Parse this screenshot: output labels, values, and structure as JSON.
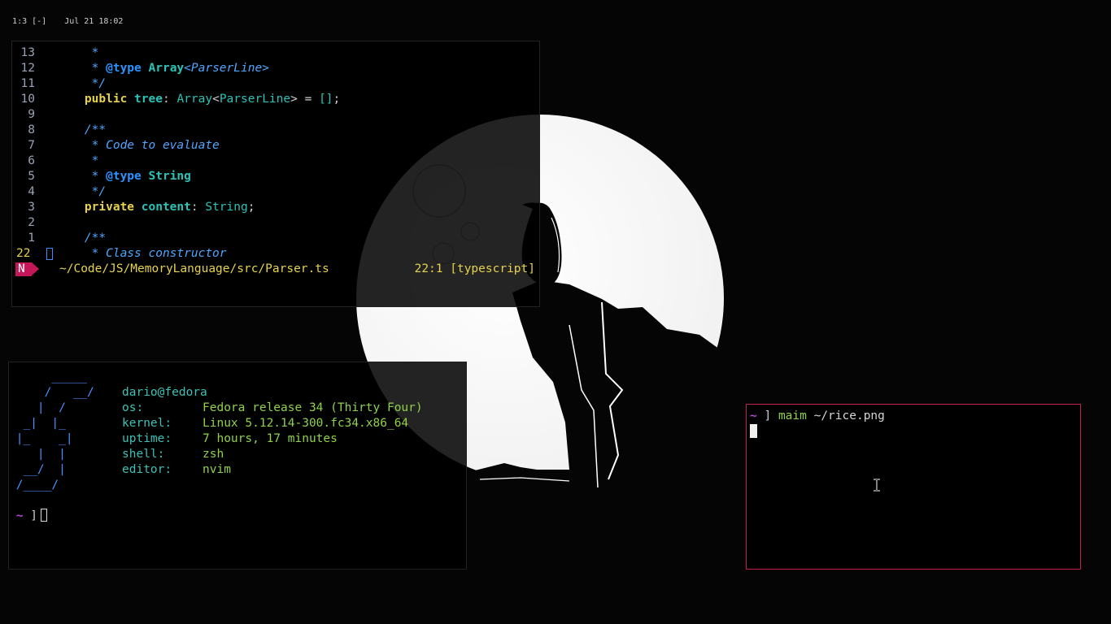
{
  "statusbar": {
    "workspaces": "1:3 [-]",
    "datetime": "Jul 21 18:02"
  },
  "editor": {
    "lines": [
      {
        "num": "13",
        "current": false,
        "tokens": [
          [
            "c-comment",
            "     *"
          ]
        ]
      },
      {
        "num": "12",
        "current": false,
        "tokens": [
          [
            "c-comment",
            "     * "
          ],
          [
            "c-tag",
            "@type"
          ],
          [
            "c-comment",
            " "
          ],
          [
            "c-type",
            "Array"
          ],
          [
            "c-gen",
            "<ParserLine>"
          ]
        ]
      },
      {
        "num": "11",
        "current": false,
        "tokens": [
          [
            "c-comment",
            "     */"
          ]
        ]
      },
      {
        "num": "10",
        "current": false,
        "tokens": [
          [
            "c-plain",
            "    "
          ],
          [
            "c-kw",
            "public"
          ],
          [
            "c-plain",
            " "
          ],
          [
            "c-prop",
            "tree"
          ],
          [
            "c-punc",
            ": "
          ],
          [
            "c-typ",
            "Array"
          ],
          [
            "c-punc",
            "<"
          ],
          [
            "c-typ",
            "ParserLine"
          ],
          [
            "c-punc",
            "> = "
          ],
          [
            "c-br",
            "[]"
          ],
          [
            "c-punc",
            ";"
          ]
        ]
      },
      {
        "num": "9",
        "current": false,
        "tokens": [
          [
            "c-plain",
            ""
          ]
        ]
      },
      {
        "num": "8",
        "current": false,
        "tokens": [
          [
            "c-comment",
            "    /**"
          ]
        ]
      },
      {
        "num": "7",
        "current": false,
        "tokens": [
          [
            "c-comment",
            "     * Code to evaluate"
          ]
        ]
      },
      {
        "num": "6",
        "current": false,
        "tokens": [
          [
            "c-comment",
            "     *"
          ]
        ]
      },
      {
        "num": "5",
        "current": false,
        "tokens": [
          [
            "c-comment",
            "     * "
          ],
          [
            "c-tag",
            "@type"
          ],
          [
            "c-comment",
            " "
          ],
          [
            "c-type",
            "String"
          ]
        ]
      },
      {
        "num": "4",
        "current": false,
        "tokens": [
          [
            "c-comment",
            "     */"
          ]
        ]
      },
      {
        "num": "3",
        "current": false,
        "tokens": [
          [
            "c-plain",
            "    "
          ],
          [
            "c-kw",
            "private"
          ],
          [
            "c-plain",
            " "
          ],
          [
            "c-prop",
            "content"
          ],
          [
            "c-punc",
            ": "
          ],
          [
            "c-typ",
            "String"
          ],
          [
            "c-punc",
            ";"
          ]
        ]
      },
      {
        "num": "2",
        "current": false,
        "tokens": [
          [
            "c-plain",
            ""
          ]
        ]
      },
      {
        "num": "1",
        "current": false,
        "tokens": [
          [
            "c-comment",
            "    /**"
          ]
        ]
      },
      {
        "num": "22",
        "current": true,
        "tokens": [
          [
            "c-comment",
            "     * Class constructor"
          ]
        ]
      }
    ],
    "mode": "N",
    "file_path": "~/Code/JS/MemoryLanguage/src/Parser.ts",
    "position": "22:1 [typescript]"
  },
  "fetch": {
    "ascii": [
      "      _____",
      "     /   __/",
      "    |  /",
      "  _|  |_",
      " |_    _|",
      "    |  |",
      "  __/  |",
      " /____/"
    ],
    "user": "dario@fedora",
    "info": [
      {
        "key": "os:",
        "value": "Fedora release 34 (Thirty Four)"
      },
      {
        "key": "kernel:",
        "value": "Linux 5.12.14-300.fc34.x86_64"
      },
      {
        "key": "uptime:",
        "value": "7 hours, 17 minutes"
      },
      {
        "key": "shell:",
        "value": "zsh"
      },
      {
        "key": "editor:",
        "value": "nvim"
      }
    ],
    "prompt_tilde": "~",
    "prompt_bracket": "]"
  },
  "shell": {
    "prompt_tilde": "~",
    "prompt_bracket": "]",
    "command": "maim",
    "argument": "~/rice.png",
    "border_color": "#c0204e"
  },
  "colors": {
    "background": "#050505",
    "moon": "#ffffff",
    "accent_pink": "#c4175a",
    "yellow": "#e7d34b",
    "cyan": "#2bc2b7",
    "blue": "#4ea6ff",
    "green": "#8fd14a",
    "purple": "#b34dd6"
  }
}
